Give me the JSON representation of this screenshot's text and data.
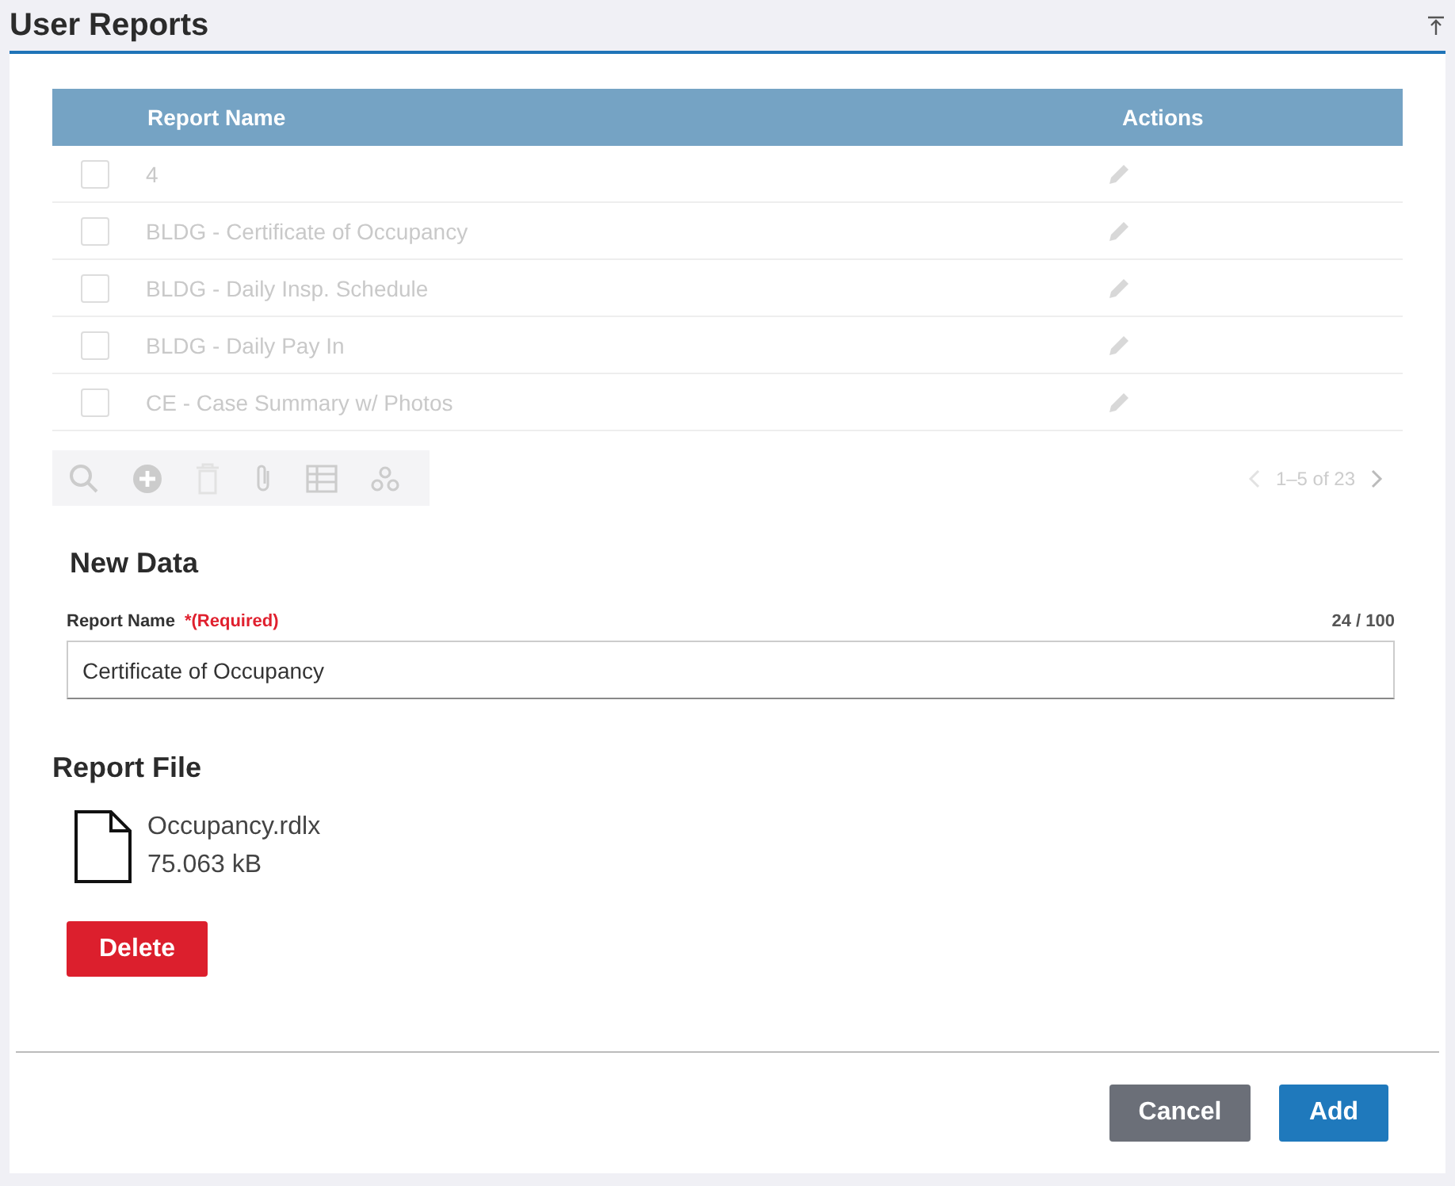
{
  "page": {
    "title": "User Reports"
  },
  "table": {
    "disabled": true,
    "columns": [
      "Report Name",
      "Actions"
    ],
    "rows": [
      {
        "name": "4",
        "checked": false
      },
      {
        "name": "BLDG - Certificate of Occupancy",
        "checked": false
      },
      {
        "name": "BLDG - Daily Insp. Schedule",
        "checked": false
      },
      {
        "name": "BLDG - Daily Pay In",
        "checked": false
      },
      {
        "name": "CE - Case Summary w/ Photos",
        "checked": false
      }
    ],
    "pager": "1–5 of 23"
  },
  "new_data": {
    "title": "New Data",
    "label": "Report Name",
    "required": "*(Required)",
    "counter": "24 / 100",
    "value": "Certificate of Occupancy"
  },
  "report_file": {
    "title": "Report File",
    "file_name": "Occupancy.rdlx",
    "file_size": "75.063 kB",
    "delete_button": "Delete"
  },
  "footer": {
    "buttons": [
      {
        "label": "Cancel",
        "kind": "secondary"
      },
      {
        "label": "Add",
        "kind": "primary"
      }
    ]
  }
}
